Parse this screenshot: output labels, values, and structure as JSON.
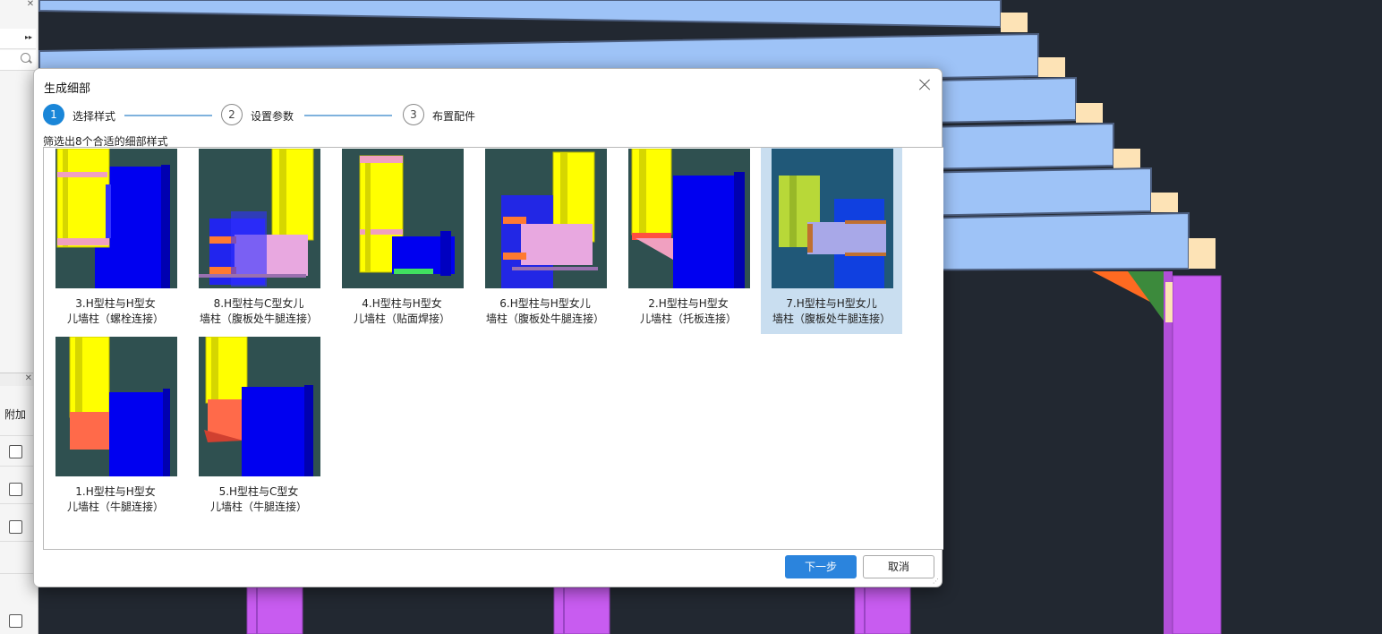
{
  "dialog": {
    "title": "生成细部",
    "steps": [
      {
        "number": "1",
        "label": "选择样式",
        "active": true
      },
      {
        "number": "2",
        "label": "设置参数",
        "active": false
      },
      {
        "number": "3",
        "label": "布置配件",
        "active": false
      }
    ],
    "filter_text": "筛选出8个合适的细部样式",
    "styles": [
      {
        "line1": "3.H型柱与H型女",
        "line2": "儿墙柱（螺栓连接）",
        "selected": false
      },
      {
        "line1": "8.H型柱与C型女儿",
        "line2": "墙柱（腹板处牛腿连接）",
        "selected": false
      },
      {
        "line1": "4.H型柱与H型女",
        "line2": "儿墙柱（贴面焊接）",
        "selected": false
      },
      {
        "line1": "6.H型柱与H型女儿",
        "line2": "墙柱（腹板处牛腿连接）",
        "selected": false
      },
      {
        "line1": "2.H型柱与H型女",
        "line2": "儿墙柱（托板连接）",
        "selected": false
      },
      {
        "line1": "7.H型柱与H型女儿",
        "line2": "墙柱（腹板处牛腿连接）",
        "selected": true
      },
      {
        "line1": "1.H型柱与H型女",
        "line2": "儿墙柱（牛腿连接）",
        "selected": false
      },
      {
        "line1": "5.H型柱与C型女",
        "line2": "儿墙柱（牛腿连接）",
        "selected": false
      }
    ],
    "next_label": "下一步",
    "cancel_label": "取消"
  },
  "side_panel": {
    "attach_label": "附加"
  },
  "colors": {
    "accent": "#1a86d8",
    "primary_button": "#2b84dd",
    "selection": "#c9def0",
    "viewport_bg": "#222831",
    "roof_panel": "#9ec3f7",
    "column_purple": "#c85cf0",
    "member_yellow": "#ffff00",
    "member_blue": "#0000f0"
  }
}
